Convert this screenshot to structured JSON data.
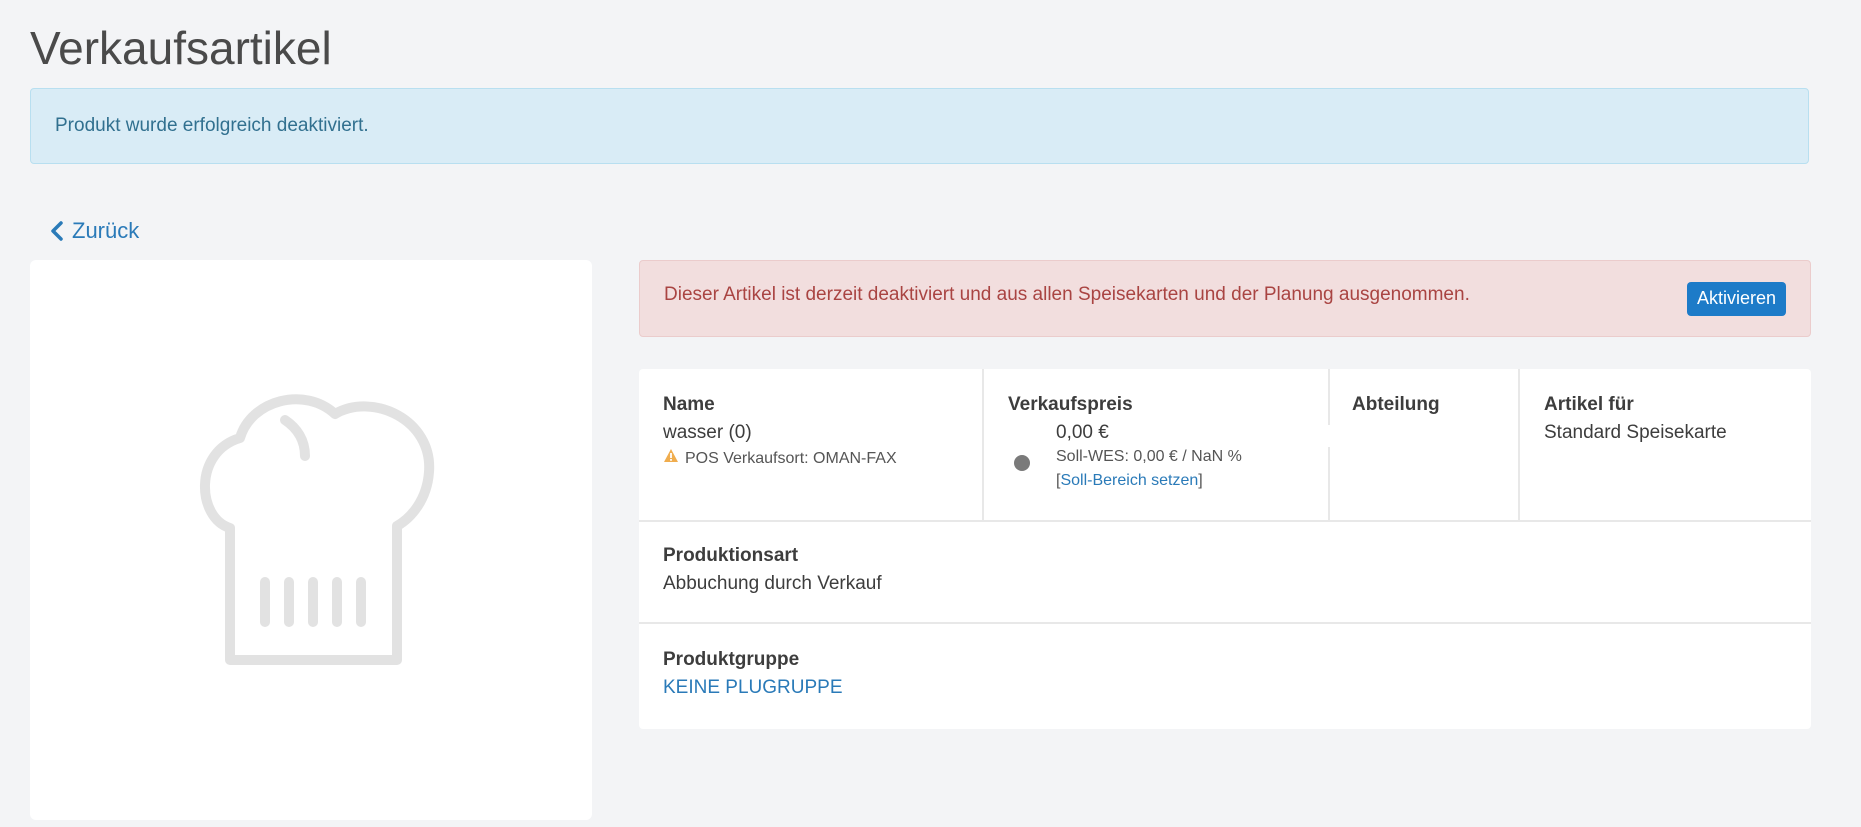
{
  "page": {
    "title": "Verkaufsartikel"
  },
  "flash": {
    "message": "Produkt wurde erfolgreich deaktiviert."
  },
  "nav": {
    "back_label": "Zurück"
  },
  "image": {
    "placeholder_icon": "chef-hat-icon"
  },
  "status_alert": {
    "message": "Dieser Artikel ist derzeit deaktiviert und aus allen Speisekarten und der Planung ausgenommen.",
    "button_label": "Aktivieren",
    "button_color": "#1d7bc8"
  },
  "details": {
    "name": {
      "label": "Name",
      "value": "wasser (0)",
      "warning": "POS Verkaufsort: OMAN-FAX"
    },
    "price": {
      "label": "Verkaufspreis",
      "value": "0,00 €",
      "target": "Soll-WES: 0,00 € / NaN %",
      "bracket_open": "[",
      "link_label": "Soll-Bereich setzen",
      "bracket_close": "]"
    },
    "department": {
      "label": "Abteilung",
      "value": ""
    },
    "article_for": {
      "label": "Artikel für",
      "value": "Standard Speisekarte"
    },
    "production": {
      "label": "Produktionsart",
      "value": "Abbuchung durch Verkauf"
    },
    "product_group": {
      "label": "Produktgruppe",
      "value": "KEINE PLUGRUPPE"
    }
  },
  "colors": {
    "link": "#2a7ab8",
    "danger_text": "#a94442",
    "info_text": "#31708f",
    "warning_icon": "#f0ad4e"
  }
}
